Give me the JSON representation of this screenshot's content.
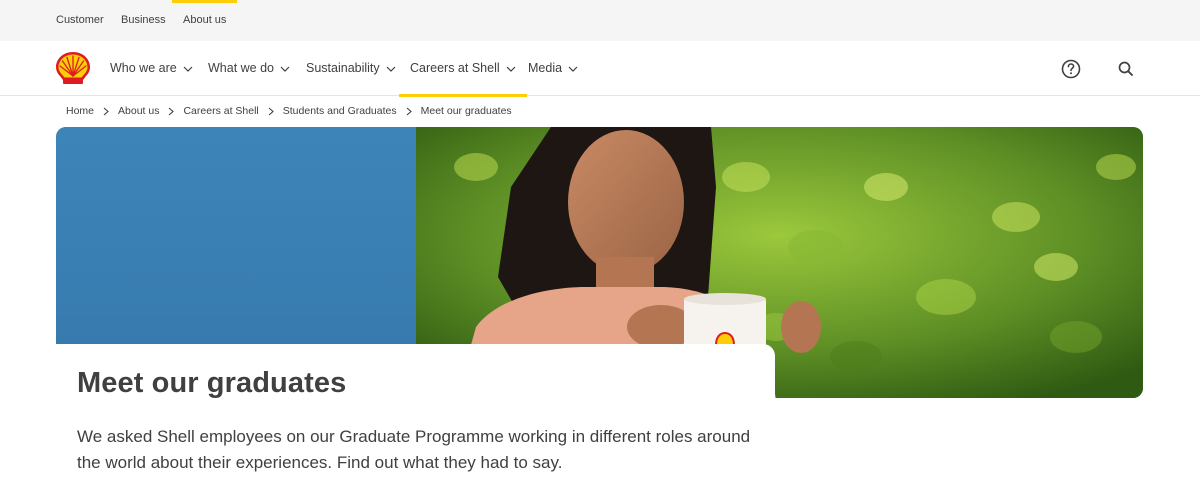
{
  "topbar": {
    "links": [
      "Customer",
      "Business",
      "About us"
    ],
    "active": "About us"
  },
  "mainnav": {
    "logo": "shell-pecten-logo",
    "items": [
      {
        "label": "Who we are",
        "active": false
      },
      {
        "label": "What we do",
        "active": false
      },
      {
        "label": "Sustainability",
        "active": false
      },
      {
        "label": "Careers at Shell",
        "active": true
      },
      {
        "label": "Media",
        "active": false
      }
    ],
    "icons": [
      "help-icon",
      "search-icon"
    ]
  },
  "breadcrumb": [
    "Home",
    "About us",
    "Careers at Shell",
    "Students and Graduates",
    "Meet our graduates"
  ],
  "hero": {
    "image": "woman-holding-shell-mug-photo"
  },
  "content": {
    "title": "Meet our graduates",
    "intro": "We asked Shell employees on our Graduate Programme working in different roles around the world about their experiences. Find out what they had to say."
  },
  "colors": {
    "accent": "#fbce07",
    "shell_red": "#dd1d21",
    "text": "#404040",
    "topbar_bg": "#f5f5f5"
  }
}
